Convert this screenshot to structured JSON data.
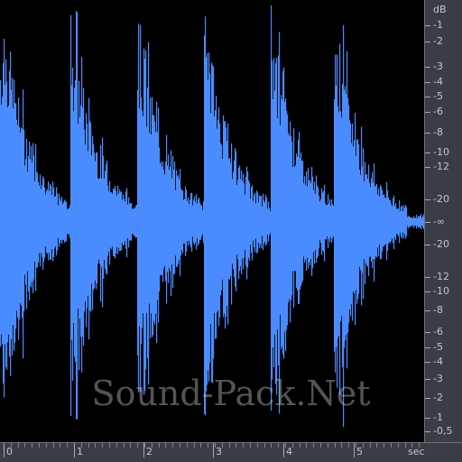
{
  "editor": {
    "db_ruler": {
      "unit": "dB",
      "labels": [
        "-1",
        "-2",
        "-3",
        "-4",
        "-5",
        "-6",
        "-8",
        "-10",
        "-12",
        "-20",
        "-∞",
        "-20",
        "-12",
        "-10",
        "-8",
        "-6",
        "-5",
        "-4",
        "-3",
        "-2",
        "-1",
        "-0,5"
      ]
    },
    "time_ruler": {
      "labels": [
        "0",
        "1",
        "2",
        "3",
        "4",
        "5"
      ],
      "unit": "sec"
    },
    "watermark": "Sound-Pack.Net",
    "colors": {
      "waveform": "#4a8cff",
      "background": "#000000",
      "ruler": "#3a3e44"
    },
    "waveform": {
      "hits": [
        0.0,
        0.95,
        1.9,
        2.85,
        3.8,
        4.7
      ],
      "duration_sec": 5.85
    }
  }
}
